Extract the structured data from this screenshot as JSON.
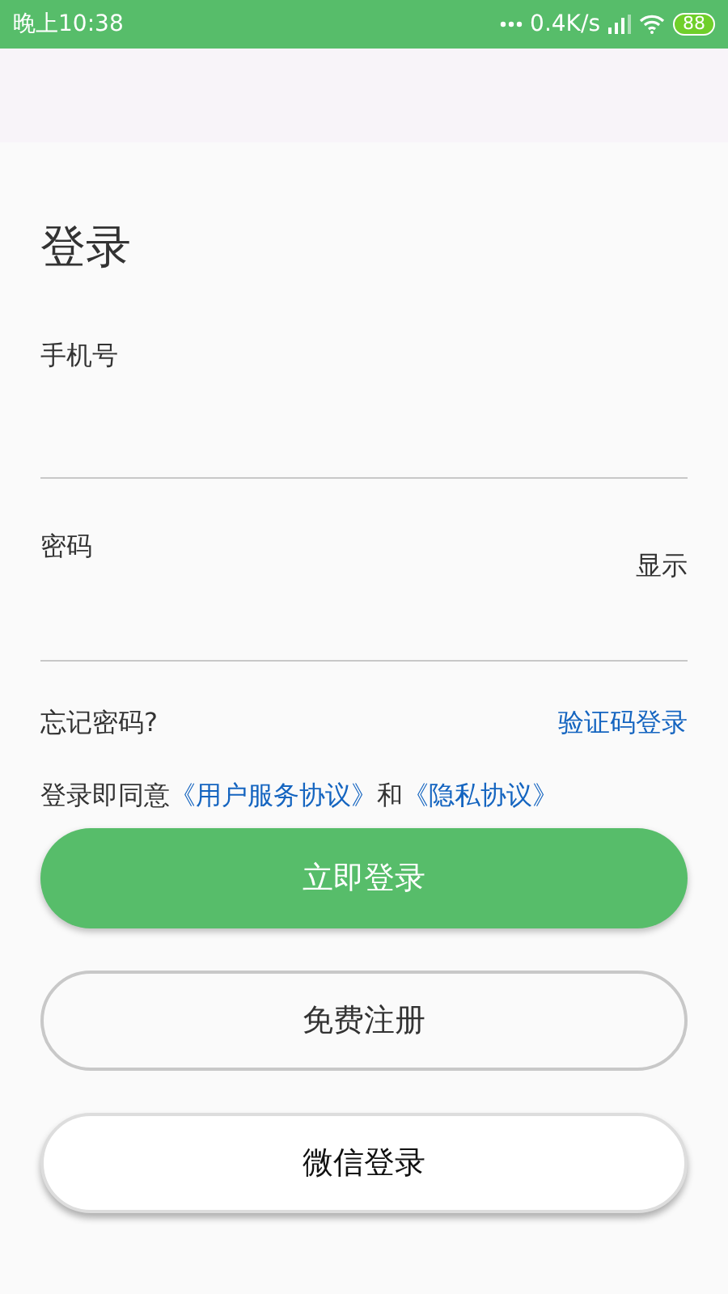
{
  "status_bar": {
    "time": "晚上10:38",
    "network_speed": "0.4K/s",
    "battery": "88"
  },
  "title": "登录",
  "fields": [
    {
      "label": "手机号"
    },
    {
      "label": "密码",
      "toggle": "显示"
    }
  ],
  "forgot_link": "忘记密码?",
  "code_login_link": "验证码登录",
  "agreement": {
    "prefix": "登录即同意",
    "link_1": "《用户服务协议》",
    "joiner": "和",
    "link_2": "《隐私协议》"
  },
  "buttons": [
    {
      "label": "立即登录",
      "kind": "primary"
    },
    {
      "label": "免费注册",
      "kind": "outline"
    },
    {
      "label": "微信登录",
      "kind": "raised"
    }
  ]
}
